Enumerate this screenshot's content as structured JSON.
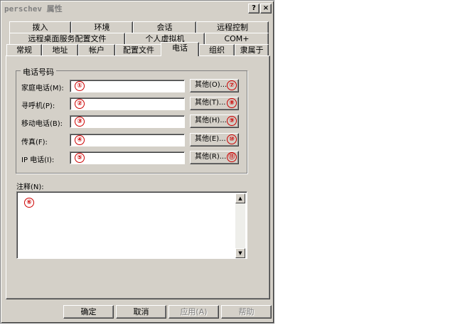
{
  "window": {
    "title": "perschev 属性",
    "help_glyph": "?",
    "close_glyph": "×"
  },
  "tabs": {
    "row1": [
      "拨入",
      "环境",
      "会话",
      "远程控制"
    ],
    "row2": [
      "远程桌面服务配置文件",
      "个人虚拟机",
      "COM+"
    ],
    "row3": [
      "常规",
      "地址",
      "帐户",
      "配置文件",
      "电话",
      "组织",
      "隶属于"
    ],
    "active": "电话"
  },
  "phone_group": {
    "label": "电话号码",
    "rows": [
      {
        "label": "家庭电话(M):",
        "value": "",
        "other_button": "其他(O)..."
      },
      {
        "label": "寻呼机(P):",
        "value": "",
        "other_button": "其他(T)..."
      },
      {
        "label": "移动电话(B):",
        "value": "",
        "other_button": "其他(H)..."
      },
      {
        "label": "传真(F):",
        "value": "",
        "other_button": "其他(E)..."
      },
      {
        "label": "IP 电话(I):",
        "value": "",
        "other_button": "其他(R)..."
      }
    ]
  },
  "notes": {
    "label": "注释(N):",
    "value": ""
  },
  "annotations": [
    "①",
    "②",
    "③",
    "④",
    "⑤",
    "⑥",
    "⑦",
    "⑧",
    "⑨",
    "⑩",
    "⑪"
  ],
  "footer": {
    "ok": "确定",
    "cancel": "取消",
    "apply": "应用(A)",
    "help": "帮助"
  },
  "colors": {
    "dialog_face": "#d4d0c8",
    "annotation_red": "#cc0000"
  }
}
